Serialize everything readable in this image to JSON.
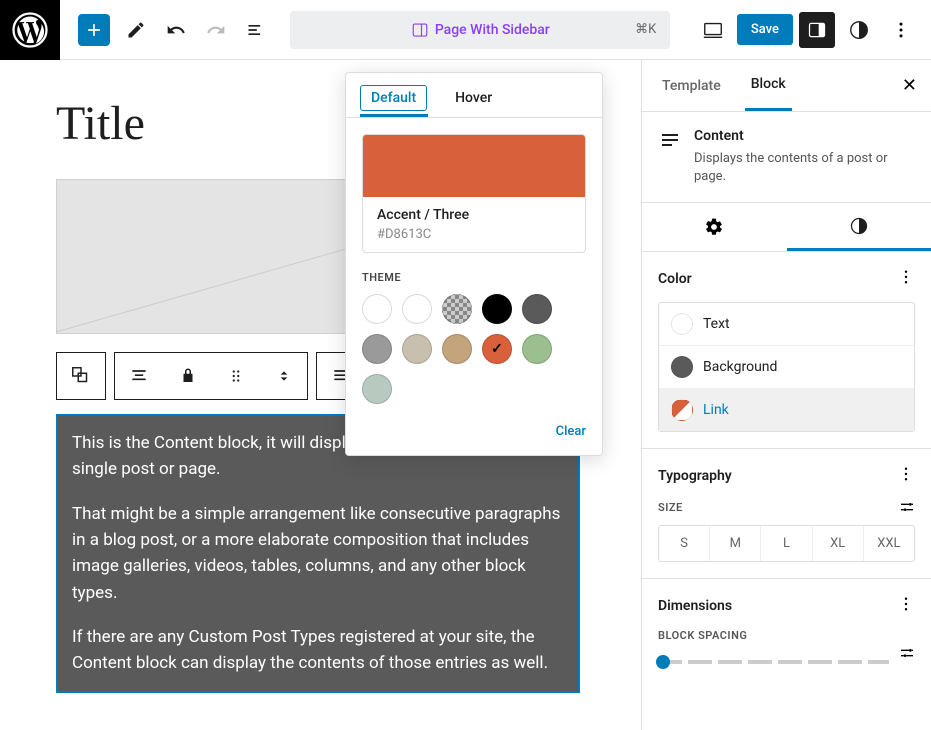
{
  "topbar": {
    "page_label": "Page With Sidebar",
    "shortcut": "⌘K",
    "save_label": "Save"
  },
  "canvas": {
    "title": "Title",
    "content_paragraphs": [
      "This is the Content block, it will display all the blocks in any single post or page.",
      "That might be a simple arrangement like consecutive paragraphs in a blog post, or a more elaborate composition that includes image galleries, videos, tables, columns, and any other block types.",
      "If there are any Custom Post Types registered at your site, the Content block can display the contents of those entries as well."
    ]
  },
  "color_popover": {
    "tabs": {
      "default": "Default",
      "hover": "Hover"
    },
    "color_name": "Accent / Three",
    "color_hex": "#D8613C",
    "theme_label": "THEME",
    "theme_swatches": [
      {
        "color": "#ffffff",
        "checked": false,
        "hatched": false
      },
      {
        "color": "#ffffff",
        "checked": false,
        "hatched": false
      },
      {
        "color": "#888888",
        "checked": false,
        "hatched": true
      },
      {
        "color": "#000000",
        "checked": false,
        "hatched": false
      },
      {
        "color": "#5a5a5a",
        "checked": false,
        "hatched": false
      },
      {
        "color": "#9a9a9a",
        "checked": false,
        "hatched": false
      },
      {
        "color": "#c9bfae",
        "checked": false,
        "hatched": false
      },
      {
        "color": "#c4a47c",
        "checked": false,
        "hatched": false
      },
      {
        "color": "#D8613C",
        "checked": true,
        "hatched": false
      },
      {
        "color": "#9bbf8f",
        "checked": false,
        "hatched": false
      },
      {
        "color": "#b8c9bf",
        "checked": false,
        "hatched": false
      }
    ],
    "clear_label": "Clear"
  },
  "sidebar": {
    "tabs": {
      "template": "Template",
      "block": "Block"
    },
    "block_info": {
      "title": "Content",
      "description": "Displays the contents of a post or page."
    },
    "color_panel": {
      "title": "Color",
      "rows": [
        {
          "label": "Text",
          "color": "#ffffff"
        },
        {
          "label": "Background",
          "color": "#5a5a5a"
        },
        {
          "label": "Link",
          "color": "split",
          "active": true
        }
      ]
    },
    "typography": {
      "title": "Typography",
      "size_label": "SIZE",
      "sizes": [
        "S",
        "M",
        "L",
        "XL",
        "XXL"
      ]
    },
    "dimensions": {
      "title": "Dimensions",
      "spacing_label": "BLOCK SPACING"
    }
  }
}
